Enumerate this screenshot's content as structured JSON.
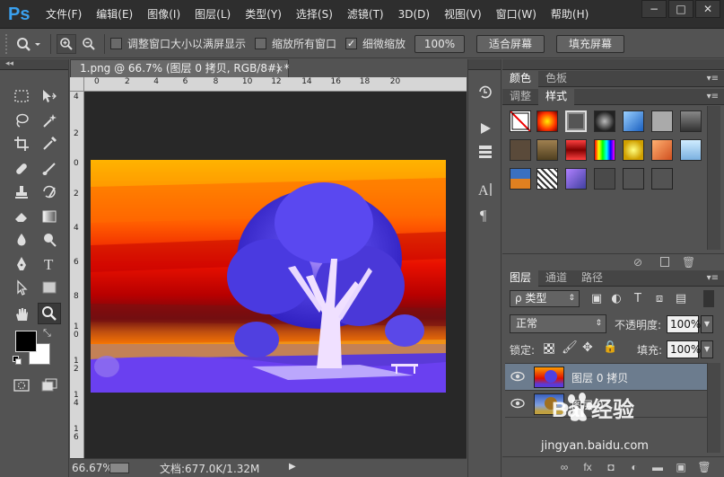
{
  "app": {
    "logo": "Ps"
  },
  "menubar": {
    "items": [
      "文件(F)",
      "编辑(E)",
      "图像(I)",
      "图层(L)",
      "类型(Y)",
      "选择(S)",
      "滤镜(T)",
      "3D(D)",
      "视图(V)",
      "窗口(W)",
      "帮助(H)"
    ],
    "window_controls": [
      "−",
      "□",
      "✕"
    ]
  },
  "options_bar": {
    "resize_windows_label": "调整窗口大小以满屏显示",
    "resize_windows_checked": false,
    "zoom_all_label": "缩放所有窗口",
    "zoom_all_checked": false,
    "scrubby_label": "细微缩放",
    "scrubby_checked": true,
    "percent_button": "100%",
    "fit_screen_button": "适合屏幕",
    "fill_screen_button": "填充屏幕"
  },
  "toolbox": {
    "collapse_label": "◂◂"
  },
  "document": {
    "tab_title": "1.png @ 66.7% (图层 0 拷贝, RGB/8#) *",
    "tab_close": "×",
    "ruler_top_ticks": [
      "0",
      "2",
      "4",
      "6",
      "8",
      "10",
      "12",
      "14",
      "16",
      "18",
      "20"
    ],
    "ruler_left_ticks": [
      "4",
      "2",
      "0",
      "2",
      "4",
      "6",
      "8",
      "1\n0",
      "1\n2",
      "1\n4",
      "1\n6"
    ]
  },
  "status_bar": {
    "zoom": "66.67%",
    "doc_info": "文档:677.0K/1.32M",
    "arrow": "▶"
  },
  "panels": {
    "color_tabs": [
      "颜色",
      "色板"
    ],
    "style_tabs": [
      "调整",
      "样式"
    ],
    "layer_tabs": [
      "图层",
      "通道",
      "路径"
    ],
    "menu_glyph": "▾≡"
  },
  "layers": {
    "filter_label": "ρ 类型",
    "blend_mode": "正常",
    "opacity_label": "不透明度:",
    "opacity_value": "100%",
    "lock_label": "锁定:",
    "fill_label": "填充:",
    "fill_value": "100%",
    "items": [
      {
        "name": "图层 0 拷贝",
        "selected": true
      },
      {
        "name": "图层 0",
        "selected": false
      }
    ]
  },
  "watermark": {
    "brand": "Bai 经验",
    "url": "jingyan.baidu.com"
  }
}
